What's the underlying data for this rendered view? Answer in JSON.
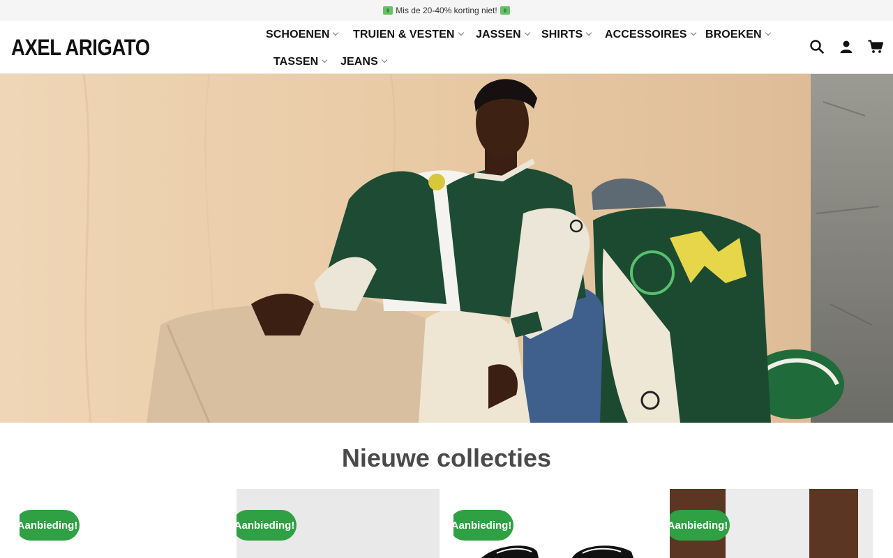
{
  "promo": {
    "text": "Mis de 20-40% korting niet!",
    "icon": "money-with-wings-emoji"
  },
  "header": {
    "logo": "AXEL ARIGATO",
    "nav": [
      {
        "label": "SCHOENEN"
      },
      {
        "label": "TRUIEN & VESTEN"
      },
      {
        "label": "JASSEN"
      },
      {
        "label": "SHIRTS"
      },
      {
        "label": "ACCESSOIRES"
      },
      {
        "label": "BROEKEN"
      },
      {
        "label": "TASSEN"
      },
      {
        "label": "JEANS"
      }
    ],
    "icons": [
      "search-icon",
      "account-icon",
      "cart-icon"
    ]
  },
  "hero": {
    "image": "model-in-varsity-jacket"
  },
  "section": {
    "title": "Nieuwe collecties"
  },
  "products": [
    {
      "badge": "Aanbieding!"
    },
    {
      "badge": "Aanbieding!"
    },
    {
      "badge": "Aanbieding!"
    },
    {
      "badge": "Aanbieding!"
    }
  ],
  "colors": {
    "badge": "#2fa043",
    "title": "#4a4a4a",
    "promo_bg": "#f5f5f5"
  }
}
